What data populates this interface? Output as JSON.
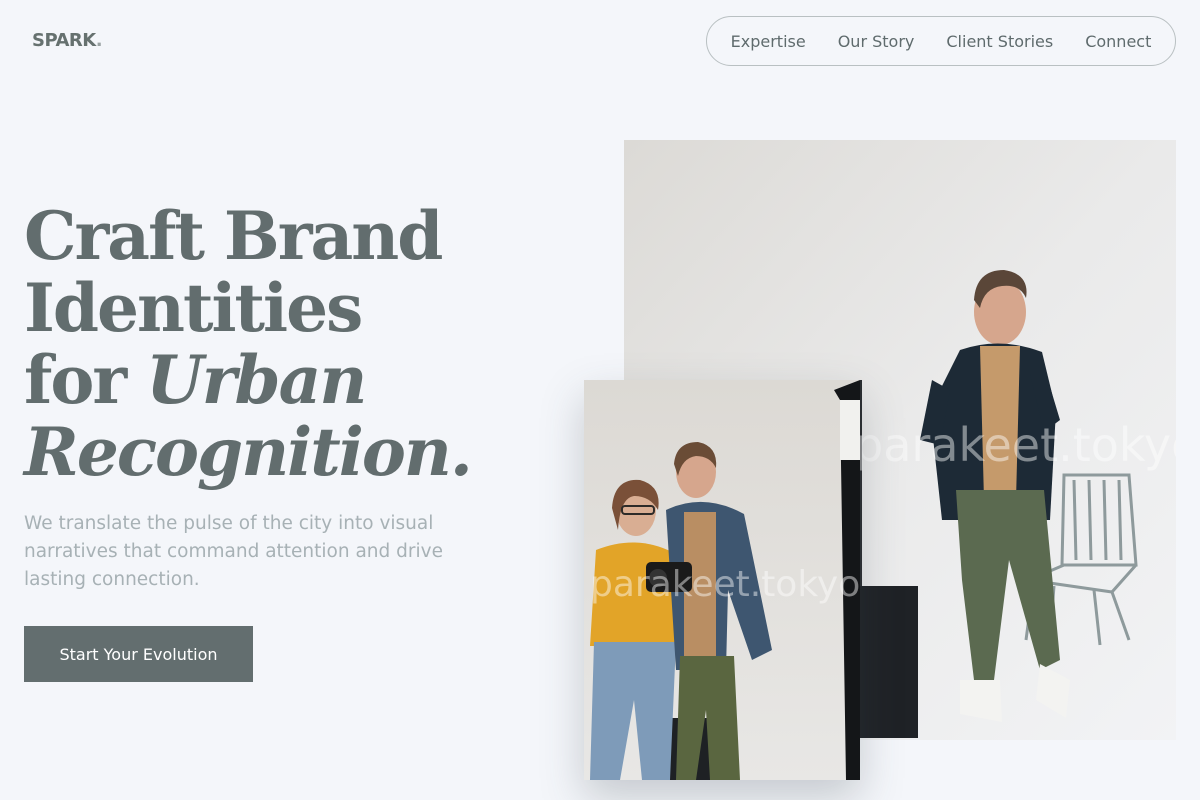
{
  "brand": {
    "name": "SPARK",
    "dot": "."
  },
  "nav": {
    "items": [
      "Expertise",
      "Our Story",
      "Client Stories",
      "Connect"
    ]
  },
  "hero": {
    "line1": "Craft Brand",
    "line2": "Identities",
    "line3_plain": "for ",
    "line3_em": "Urban",
    "line4_em": "Recognition.",
    "subtext": "We translate the pulse of the city into visual narratives that command attention and drive lasting connection.",
    "cta": "Start Your Evolution"
  },
  "photos": {
    "watermark": "parakeet.tokyo"
  },
  "colors": {
    "background": "#f4f6fa",
    "text": "#626d6e",
    "muted": "#a7b1b5",
    "button": "#636e6f"
  }
}
